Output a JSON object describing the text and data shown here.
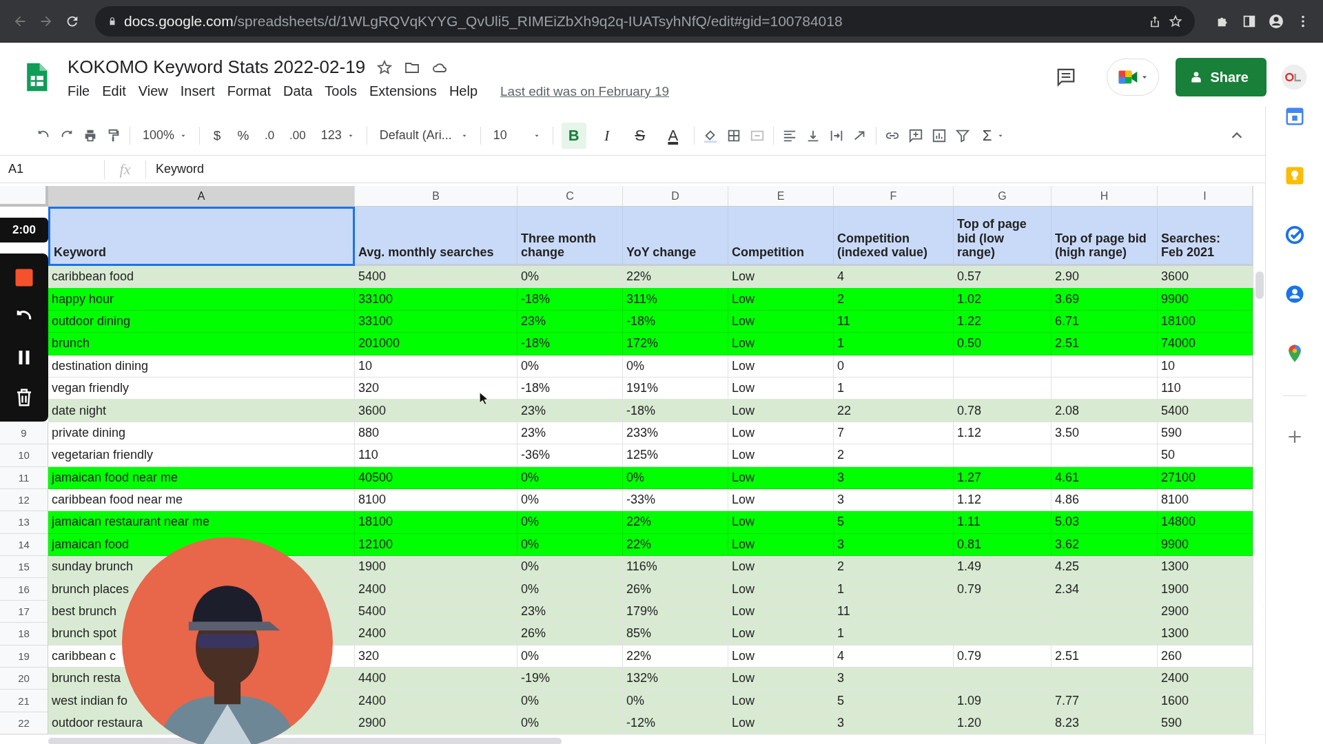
{
  "browser": {
    "url": "**docs.google.com**/spreadsheets/d/1WLgRQVqKYYG_QvUli5_RIMEiZbXh9q2q-IUATsyhNfQ/edit#gid=100784018"
  },
  "document": {
    "title": "KOKOMO Keyword Stats 2022-02-19",
    "menu": [
      "File",
      "Edit",
      "View",
      "Insert",
      "Format",
      "Data",
      "Tools",
      "Extensions",
      "Help"
    ],
    "last_edit": "Last edit was on February 19",
    "share": "Share"
  },
  "toolbar": {
    "zoom": "100%",
    "currency": "$",
    "percent": "%",
    "decrease_decimals": ".0",
    "increase_decimals": ".00",
    "number_format": "123",
    "font": "Default (Ari...",
    "font_size": "10",
    "styles": [
      {
        "kind": "bold",
        "label": "B",
        "selected": true
      },
      {
        "kind": "italic",
        "label": "I",
        "selected": false
      },
      {
        "kind": "strike",
        "label": "S",
        "selected": false
      },
      {
        "kind": "color",
        "label": "A",
        "selected": false
      }
    ],
    "functions": "Σ"
  },
  "formula_bar": {
    "cell": "A1",
    "fx": "fx",
    "value": "Keyword"
  },
  "recorder": {
    "timer": "2:00"
  },
  "sheet": {
    "column_letters": [
      "A",
      "B",
      "C",
      "D",
      "E",
      "F",
      "G",
      "H",
      "I"
    ],
    "header": [
      "Keyword",
      "Avg. monthly searches",
      "Three month change",
      "YoY change",
      "Competition",
      "Competition (indexed value)",
      "Top of page bid (low range)",
      "Top of page bid (high range)",
      "Searches: Feb 2021"
    ],
    "rows": [
      {
        "color": "#d9ead3",
        "cells": [
          "caribbean food",
          "5400",
          "0%",
          "22%",
          "Low",
          "4",
          "0.57",
          "2.90",
          "3600"
        ]
      },
      {
        "color": "#00ff00",
        "cells": [
          "happy hour",
          "33100",
          "-18%",
          "311%",
          "Low",
          "2",
          "1.02",
          "3.69",
          "9900"
        ]
      },
      {
        "color": "#00ff00",
        "cells": [
          "outdoor dining",
          "33100",
          "23%",
          "-18%",
          "Low",
          "11",
          "1.22",
          "6.71",
          "18100"
        ]
      },
      {
        "color": "#00ff00",
        "cells": [
          "brunch",
          "201000",
          "-18%",
          "172%",
          "Low",
          "1",
          "0.50",
          "2.51",
          "74000"
        ]
      },
      {
        "color": "#ffffff",
        "cells": [
          "destination dining",
          "10",
          "0%",
          "0%",
          "Low",
          "0",
          null,
          null,
          "10"
        ]
      },
      {
        "color": "#ffffff",
        "cells": [
          "vegan friendly",
          "320",
          "-18%",
          "191%",
          "Low",
          "1",
          null,
          null,
          "110"
        ]
      },
      {
        "color": "#d9ead3",
        "cells": [
          "date night",
          "3600",
          "23%",
          "-18%",
          "Low",
          "22",
          "0.78",
          "2.08",
          "5400"
        ]
      },
      {
        "number": "9",
        "color": "#ffffff",
        "cells": [
          "private dining",
          "880",
          "23%",
          "233%",
          "Low",
          "7",
          "1.12",
          "3.50",
          "590"
        ]
      },
      {
        "number": "10",
        "color": "#ffffff",
        "cells": [
          "vegetarian friendly",
          "110",
          "-36%",
          "125%",
          "Low",
          "2",
          null,
          null,
          "50"
        ]
      },
      {
        "number": "11",
        "color": "#00ff00",
        "cells": [
          "jamaican food near me",
          "40500",
          "0%",
          "0%",
          "Low",
          "3",
          "1.27",
          "4.61",
          "27100"
        ]
      },
      {
        "number": "12",
        "color": "#ffffff",
        "cells": [
          "caribbean food near me",
          "8100",
          "0%",
          "-33%",
          "Low",
          "3",
          "1.12",
          "4.86",
          "8100"
        ]
      },
      {
        "number": "13",
        "color": "#00ff00",
        "cells": [
          "jamaican restaurant near me",
          "18100",
          "0%",
          "22%",
          "Low",
          "5",
          "1.11",
          "5.03",
          "14800"
        ]
      },
      {
        "number": "14",
        "color": "#00ff00",
        "cells": [
          "jamaican food",
          "12100",
          "0%",
          "22%",
          "Low",
          "3",
          "0.81",
          "3.62",
          "9900"
        ]
      },
      {
        "number": "15",
        "color": "#d9ead3",
        "cells": [
          "sunday brunch",
          "1900",
          "0%",
          "116%",
          "Low",
          "2",
          "1.49",
          "4.25",
          "1300"
        ]
      },
      {
        "number": "16",
        "color": "#d9ead3",
        "cells": [
          "brunch places",
          "2400",
          "0%",
          "26%",
          "Low",
          "1",
          "0.79",
          "2.34",
          "1900"
        ]
      },
      {
        "number": "17",
        "color": "#d9ead3",
        "cells": [
          "best brunch",
          "5400",
          "23%",
          "179%",
          "Low",
          "11",
          null,
          null,
          "2900"
        ]
      },
      {
        "number": "18",
        "color": "#d9ead3",
        "cells": [
          "brunch spot",
          "2400",
          "26%",
          "85%",
          "Low",
          "1",
          null,
          null,
          "1300"
        ]
      },
      {
        "number": "19",
        "color": "#ffffff",
        "cells": [
          "caribbean c",
          "320",
          "0%",
          "22%",
          "Low",
          "4",
          "0.79",
          "2.51",
          "260"
        ]
      },
      {
        "number": "20",
        "color": "#d9ead3",
        "cells": [
          "brunch resta",
          "4400",
          "-19%",
          "132%",
          "Low",
          "3",
          null,
          null,
          "2400"
        ]
      },
      {
        "number": "21",
        "color": "#d9ead3",
        "cells": [
          "west indian fo",
          "2400",
          "0%",
          "0%",
          "Low",
          "5",
          "1.09",
          "7.77",
          "1600"
        ]
      },
      {
        "number": "22",
        "color": "#d9ead3",
        "cells": [
          "outdoor restaura",
          "2900",
          "0%",
          "-12%",
          "Low",
          "3",
          "1.20",
          "8.23",
          "590"
        ]
      }
    ]
  }
}
